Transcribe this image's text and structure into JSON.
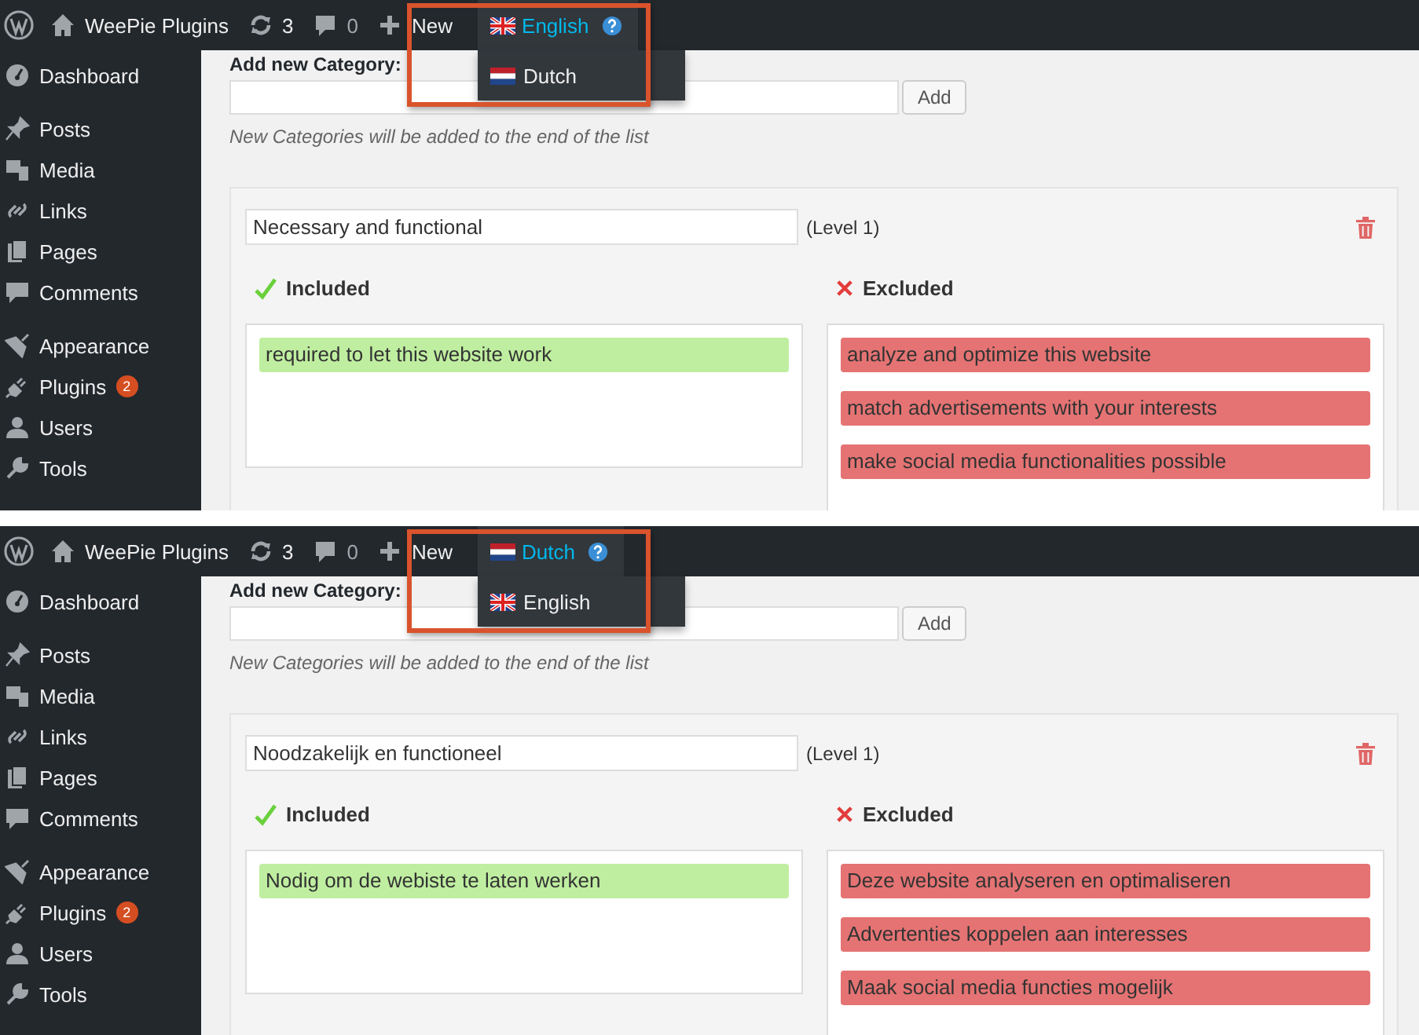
{
  "panels": [
    {
      "admin_bar": {
        "site_name": "WeePie Plugins",
        "updates_count": "3",
        "comments_count": "0",
        "new_label": "New",
        "language": {
          "current": {
            "label": "English",
            "kind": "uk"
          },
          "options": [
            {
              "label": "Dutch",
              "kind": "nl"
            }
          ]
        }
      },
      "sidebar": {
        "groups": [
          [
            {
              "label": "Dashboard",
              "kind": "dashboard"
            }
          ],
          [
            {
              "label": "Posts",
              "kind": "pin"
            },
            {
              "label": "Media",
              "kind": "media"
            },
            {
              "label": "Links",
              "kind": "link"
            },
            {
              "label": "Pages",
              "kind": "pages"
            },
            {
              "label": "Comments",
              "kind": "comment"
            }
          ],
          [
            {
              "label": "Appearance",
              "kind": "brush"
            },
            {
              "label": "Plugins",
              "kind": "plug",
              "badge": "2"
            },
            {
              "label": "Users",
              "kind": "user"
            },
            {
              "label": "Tools",
              "kind": "wrench"
            }
          ]
        ]
      },
      "content": {
        "add_category": {
          "label": "Add new Category:",
          "button": "Add",
          "hint": "New Categories will be added to the end of the list"
        },
        "category": {
          "name": "Necessary and functional",
          "level": "(Level 1)",
          "included": {
            "heading": "Included",
            "items": [
              "required to let this website work"
            ]
          },
          "excluded": {
            "heading": "Excluded",
            "items": [
              "analyze and optimize this website",
              "match advertisements with your interests",
              "make social media functionalities possible"
            ]
          }
        }
      }
    },
    {
      "admin_bar": {
        "site_name": "WeePie Plugins",
        "updates_count": "3",
        "comments_count": "0",
        "new_label": "New",
        "language": {
          "current": {
            "label": "Dutch",
            "kind": "nl"
          },
          "options": [
            {
              "label": "English",
              "kind": "uk"
            }
          ]
        }
      },
      "sidebar": {
        "groups": [
          [
            {
              "label": "Dashboard",
              "kind": "dashboard"
            }
          ],
          [
            {
              "label": "Posts",
              "kind": "pin"
            },
            {
              "label": "Media",
              "kind": "media"
            },
            {
              "label": "Links",
              "kind": "link"
            },
            {
              "label": "Pages",
              "kind": "pages"
            },
            {
              "label": "Comments",
              "kind": "comment"
            }
          ],
          [
            {
              "label": "Appearance",
              "kind": "brush"
            },
            {
              "label": "Plugins",
              "kind": "plug",
              "badge": "2"
            },
            {
              "label": "Users",
              "kind": "user"
            },
            {
              "label": "Tools",
              "kind": "wrench"
            }
          ]
        ]
      },
      "content": {
        "add_category": {
          "label": "Add new Category:",
          "button": "Add",
          "hint": "New Categories will be added to the end of the list"
        },
        "category": {
          "name": "Noodzakelijk en functioneel",
          "level": "(Level 1)",
          "included": {
            "heading": "Included",
            "items": [
              "Nodig om de webiste te laten werken"
            ]
          },
          "excluded": {
            "heading": "Excluded",
            "items": [
              "Deze website analyseren en optimaliseren",
              "Advertenties koppelen aan interesses",
              "Maak social media functies mogelijk"
            ]
          }
        }
      }
    }
  ]
}
